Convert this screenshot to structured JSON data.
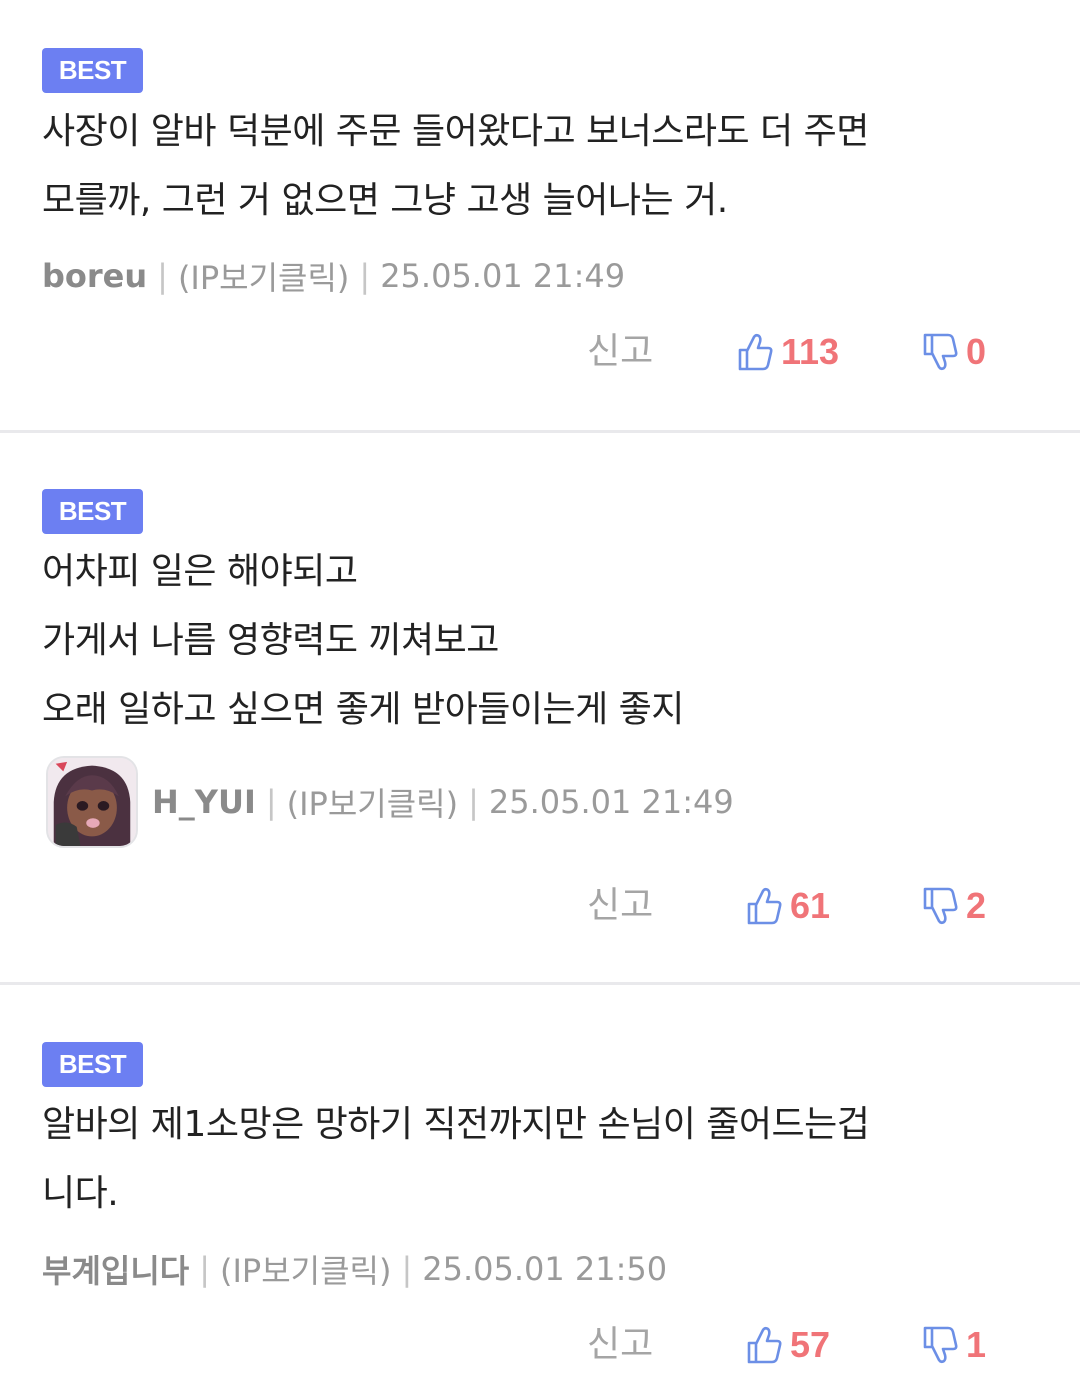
{
  "colors": {
    "badge_bg": "#6c7ff2",
    "vote_count": "#f07478",
    "vote_icon": "#6c8fe6",
    "meta_text": "#9a9a9a",
    "divider": "#e9e9ec"
  },
  "comments": [
    {
      "badge": "BEST",
      "lines": [
        "사장이 알바 덕분에 주문 들어왔다고 보너스라도 더 주면",
        "모를까, 그런 거 없으면 그냥 고생 늘어나는 거."
      ],
      "nickname": "boreu",
      "ip_label": "(IP보기클릭)",
      "datetime": "25.05.01 21:49",
      "report_label": "신고",
      "upvotes": "113",
      "downvotes": "0",
      "up_icon": "thumbs-up-icon",
      "down_icon": "thumbs-down-icon"
    },
    {
      "badge": "BEST",
      "lines": [
        "어차피 일은 해야되고",
        "가게서 나름 영향력도 끼쳐보고",
        "오래 일하고 싶으면 좋게 받아들이는게 좋지"
      ],
      "nickname": "H_YUI",
      "ip_label": "(IP보기클릭)",
      "datetime": "25.05.01 21:49",
      "report_label": "신고",
      "upvotes": "61",
      "downvotes": "2",
      "up_icon": "thumbs-up-icon",
      "down_icon": "thumbs-down-icon"
    },
    {
      "badge": "BEST",
      "lines": [
        "알바의 제1소망은 망하기 직전까지만 손님이 줄어드는겁",
        "니다."
      ],
      "nickname": "부계입니다",
      "ip_label": "(IP보기클릭)",
      "datetime": "25.05.01 21:50",
      "report_label": "신고",
      "upvotes": "57",
      "downvotes": "1",
      "up_icon": "thumbs-up-icon",
      "down_icon": "thumbs-down-icon"
    }
  ]
}
